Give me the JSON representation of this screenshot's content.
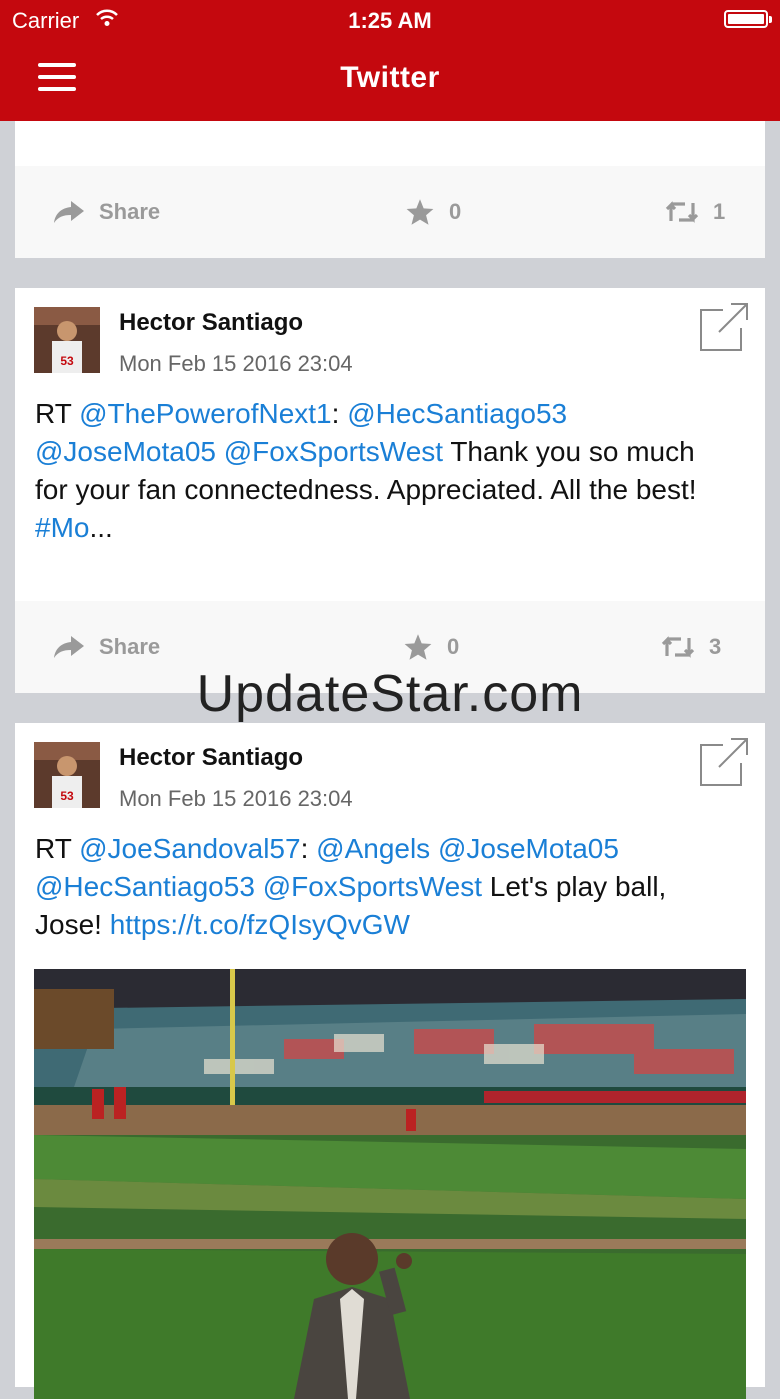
{
  "status_bar": {
    "carrier": "Carrier",
    "time": "1:25 AM"
  },
  "nav": {
    "title": "Twitter",
    "menu_icon": "hamburger-menu-icon"
  },
  "colors": {
    "header": "#c4080e",
    "link": "#1a7fd6",
    "background": "#cfd1d6"
  },
  "cards": [
    {
      "share_label": "Share",
      "favorites": "0",
      "retweets": "1"
    },
    {
      "author": "Hector Santiago",
      "date": "Mon Feb 15 2016 23:04",
      "text": {
        "prefix": "RT ",
        "l1": "@ThePowerofNext1",
        "t1": ": ",
        "l2": "@HecSantiago53",
        "t2": " ",
        "l3": "@JoseMota05",
        "t3": " ",
        "l4": "@FoxSportsWest",
        "t4": " Thank you so much for your fan connectedness. Appreciated. All the best! ",
        "l5": "#Mo",
        "t5": "..."
      },
      "share_label": "Share",
      "favorites": "0",
      "retweets": "3"
    },
    {
      "author": "Hector Santiago",
      "date": "Mon Feb 15 2016 23:04",
      "text": {
        "prefix": "RT ",
        "l1": "@JoeSandoval57",
        "t1": ": ",
        "l2": "@Angels",
        "t2": " ",
        "l3": "@JoseMota05",
        "t3": " ",
        "l4": "@HecSantiago53",
        "t4": " ",
        "l5": "@FoxSportsWest",
        "t5": " Let's play ball, Jose! ",
        "l6": "https://t.co/fzQIsyQvGW"
      }
    }
  ],
  "watermark": "UpdateStar.com"
}
